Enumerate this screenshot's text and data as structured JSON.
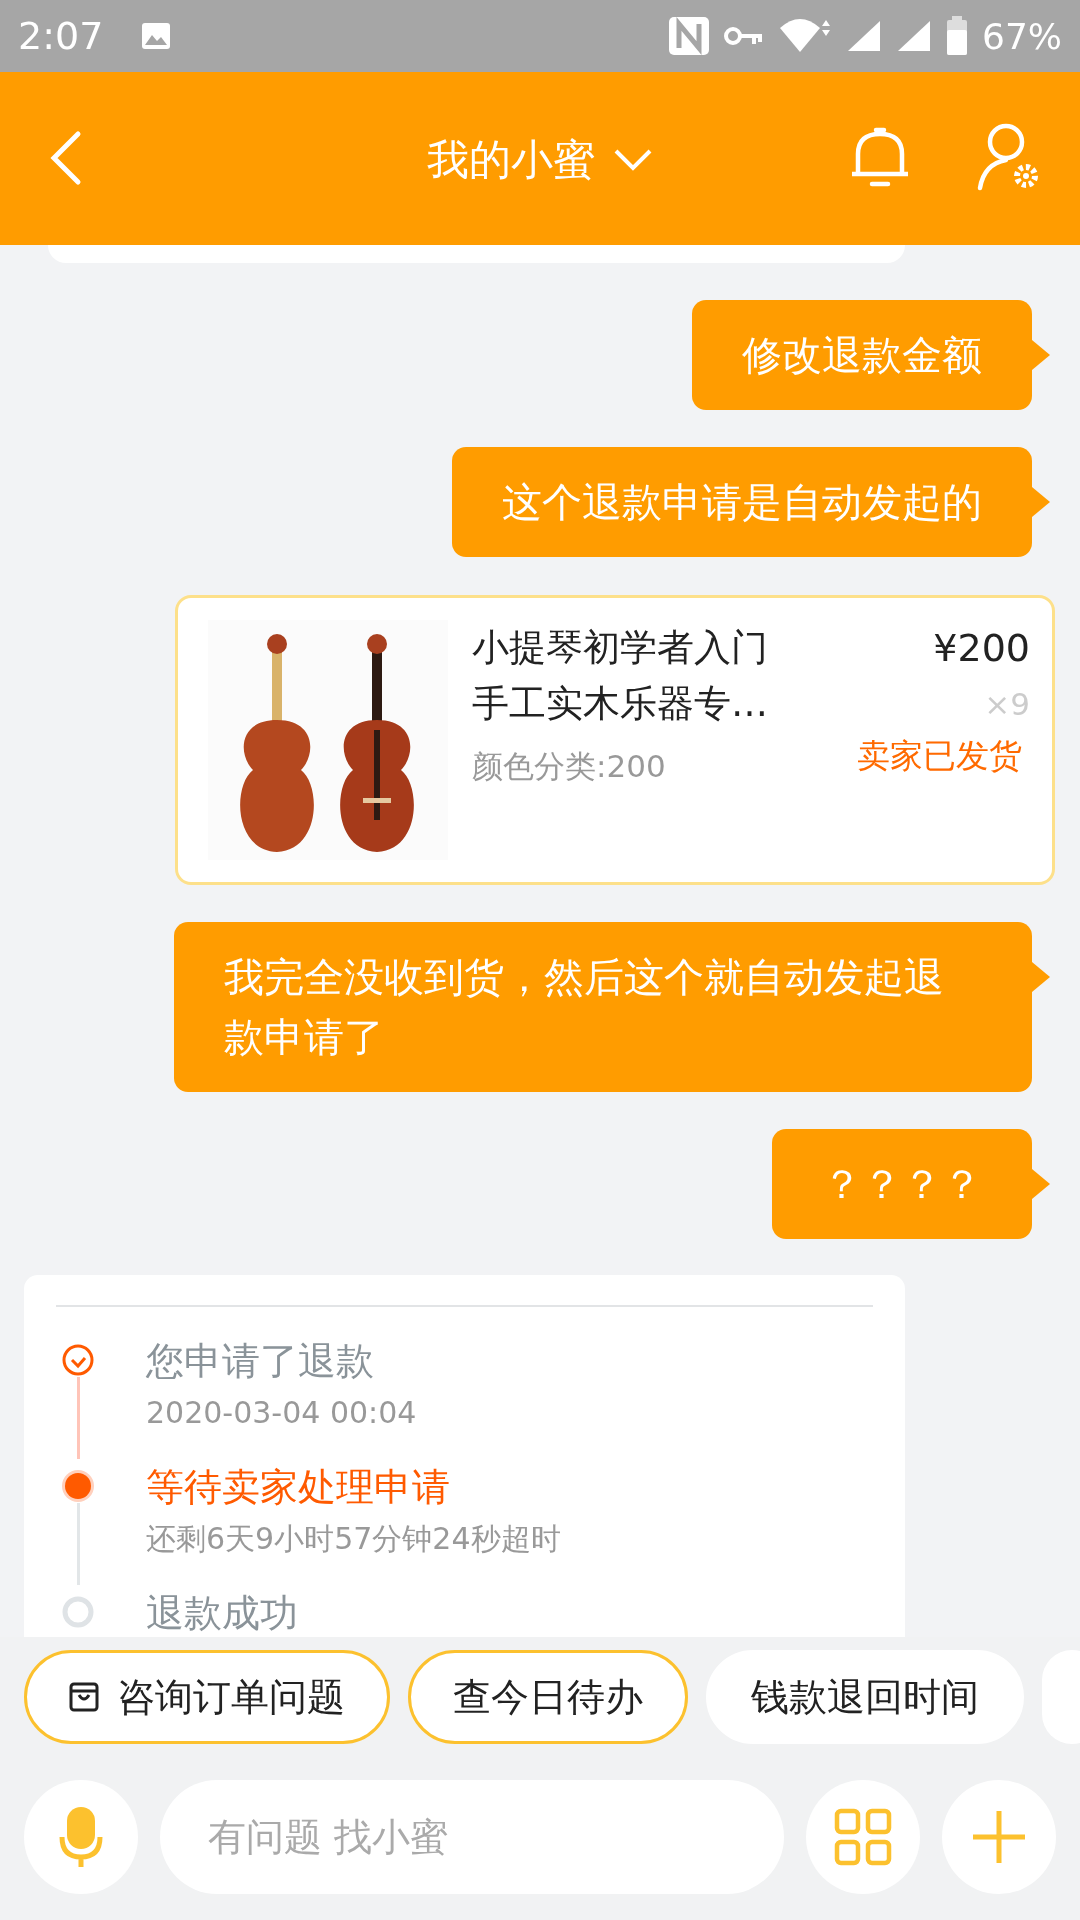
{
  "status_bar": {
    "time": "2:07",
    "battery": "67%"
  },
  "header": {
    "title": "我的小蜜"
  },
  "messages": [
    {
      "kind": "text",
      "text": "修改退款金额"
    },
    {
      "kind": "text",
      "text": "这个退款申请是自动发起的"
    },
    {
      "kind": "product",
      "title_lines": [
        "小提琴初学者入门",
        "手工实木乐器专…"
      ],
      "price": "¥200",
      "quantity": "×9",
      "spec": "颜色分类:200",
      "status": "卖家已发货"
    },
    {
      "kind": "text",
      "text": "我完全没收到货，然后这个就自动发起退款申请了"
    },
    {
      "kind": "text",
      "text": "？？？？"
    }
  ],
  "refund_progress": {
    "steps": [
      {
        "title": "您申请了退款",
        "subtitle": "2020-03-04 00:04",
        "completed": true,
        "current": false
      },
      {
        "title": "等待卖家处理申请",
        "subtitle": "还剩6天9小时57分钟24秒超时",
        "completed": false,
        "current": true
      },
      {
        "title": "退款成功",
        "completed": false,
        "current": false
      }
    ]
  },
  "quick_replies": [
    {
      "label": "咨询订单问题",
      "highlighted": true,
      "icon": true
    },
    {
      "label": "查今日待办",
      "highlighted": true,
      "icon": false
    },
    {
      "label": "钱款退回时间",
      "highlighted": false,
      "icon": false
    }
  ],
  "input": {
    "placeholder": "有问题 找小蜜"
  }
}
